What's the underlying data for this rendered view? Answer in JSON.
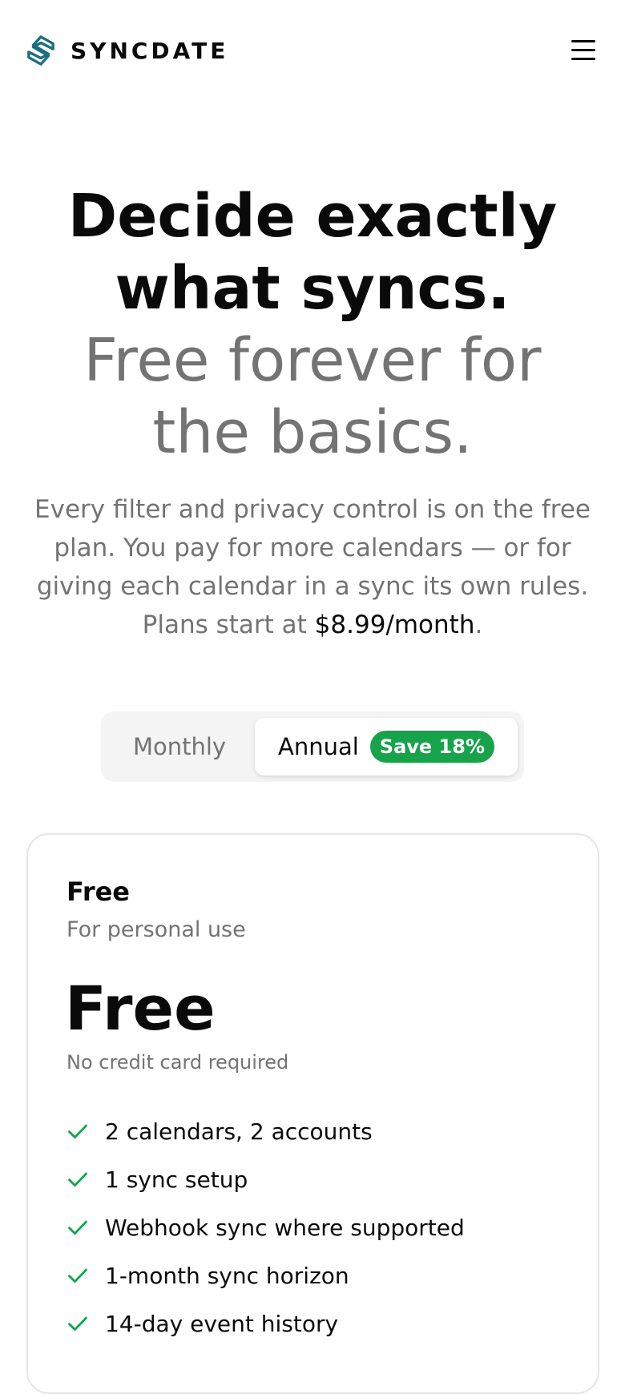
{
  "header": {
    "brand": "SYNCDATE",
    "logo_icon": "syncdate-logo-icon",
    "menu_icon": "hamburger-menu-icon"
  },
  "hero": {
    "headline": "Decide exactly what syncs.",
    "subheadline": "Free forever for the basics.",
    "intro_text": "Every filter and privacy control is on the free plan. You pay for more calendars — or for giving each calendar in a sync its own rules. Plans start at ",
    "intro_price": "$8.99/month",
    "intro_end": "."
  },
  "billing_toggle": {
    "monthly_label": "Monthly",
    "annual_label": "Annual",
    "save_badge": "Save 18%",
    "selected": "Annual"
  },
  "plan": {
    "name": "Free",
    "description": "For personal use",
    "price": "Free",
    "note": "No credit card required",
    "features": [
      "2 calendars, 2 accounts",
      "1 sync setup",
      "Webhook sync where supported",
      "1-month sync horizon",
      "14-day event history"
    ]
  },
  "colors": {
    "brand": "#1a6e80",
    "accent_green": "#16a34a",
    "muted_text": "#737373"
  }
}
